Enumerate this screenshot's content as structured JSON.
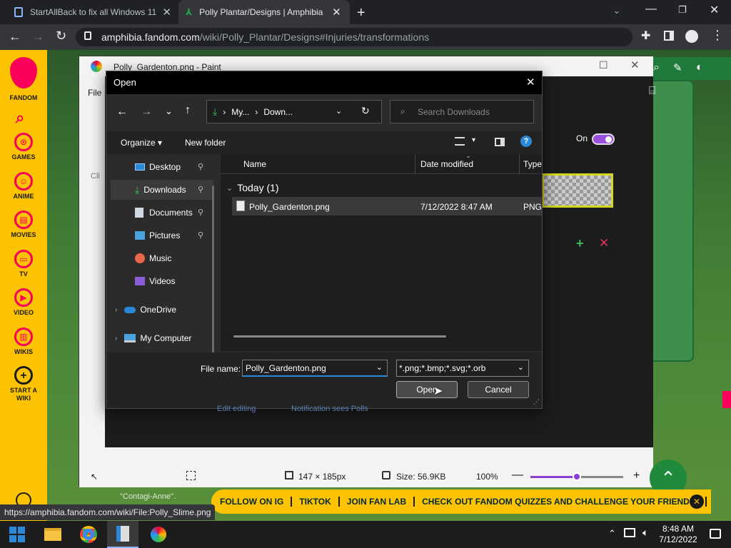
{
  "browser": {
    "tabs": [
      {
        "title": "StartAllBack to fix all Windows 11"
      },
      {
        "title": "Polly Plantar/Designs | Amphibia"
      }
    ],
    "url_host": "amphibia.fandom.com",
    "url_path": "/wiki/Polly_Plantar/Designs#Injuries/transformations",
    "status_url": "https://amphibia.fandom.com/wiki/File:Polly_Slime.png"
  },
  "fandom": {
    "brand": "FANDOM",
    "rail": [
      "GAMES",
      "ANIME",
      "MOVIES",
      "TV",
      "VIDEO",
      "WIKIS"
    ],
    "start_wiki": [
      "START A",
      "WIKI"
    ],
    "toggle_label": "On",
    "partial_text_1": "Cli",
    "partial_text_2": "File",
    "banner": [
      "FOLLOW ON IG",
      "TIKTOK",
      "JOIN FAN LAB",
      "CHECK OUT FANDOM QUIZZES AND CHALLENGE YOUR FRIENDS!"
    ],
    "bg_text_1": "\"Contagi-Anne\".",
    "bg_link_1": "Edit editing",
    "bg_link_2": "Notification sees Polls"
  },
  "paint": {
    "title": "Polly_Gardenton.png - Paint",
    "status": {
      "dimensions": "147 × 185px",
      "size": "Size: 56.9KB",
      "zoom": "100%",
      "zoom_fraction": 0.5
    }
  },
  "dialog": {
    "title": "Open",
    "breadcrumb": [
      "My...",
      "Down..."
    ],
    "search_placeholder": "Search Downloads",
    "organize": "Organize",
    "new_folder": "New folder",
    "nav": [
      {
        "label": "Desktop",
        "icon": "desktop-icon",
        "pinned": true
      },
      {
        "label": "Downloads",
        "icon": "download-icon",
        "pinned": true,
        "selected": true
      },
      {
        "label": "Documents",
        "icon": "document-icon",
        "pinned": true
      },
      {
        "label": "Pictures",
        "icon": "picture-icon",
        "pinned": true
      },
      {
        "label": "Music",
        "icon": "music-icon",
        "pinned": false
      },
      {
        "label": "Videos",
        "icon": "video-icon",
        "pinned": false
      },
      {
        "label": "OneDrive",
        "icon": "cloud-icon",
        "pinned": false
      },
      {
        "label": "My Computer",
        "icon": "computer-icon",
        "pinned": false
      }
    ],
    "columns": [
      "Name",
      "Date modified",
      "Type"
    ],
    "group_label": "Today (1)",
    "files": [
      {
        "name": "Polly_Gardenton.png",
        "date": "7/12/2022 8:47 AM",
        "type": "PNG"
      }
    ],
    "file_name_label": "File name:",
    "file_name_value": "Polly_Gardenton.png",
    "filter": "*.png;*.bmp;*.svg;*.orb",
    "open_label": "Open",
    "cancel_label": "Cancel"
  },
  "taskbar": {
    "time": "8:48 AM",
    "date": "7/12/2022"
  },
  "colors": {
    "fandom_yellow": "#fec300",
    "fandom_pink": "#fa005a",
    "dialog_bg": "#2b2b2b",
    "accent_blue": "#2b88d8"
  }
}
